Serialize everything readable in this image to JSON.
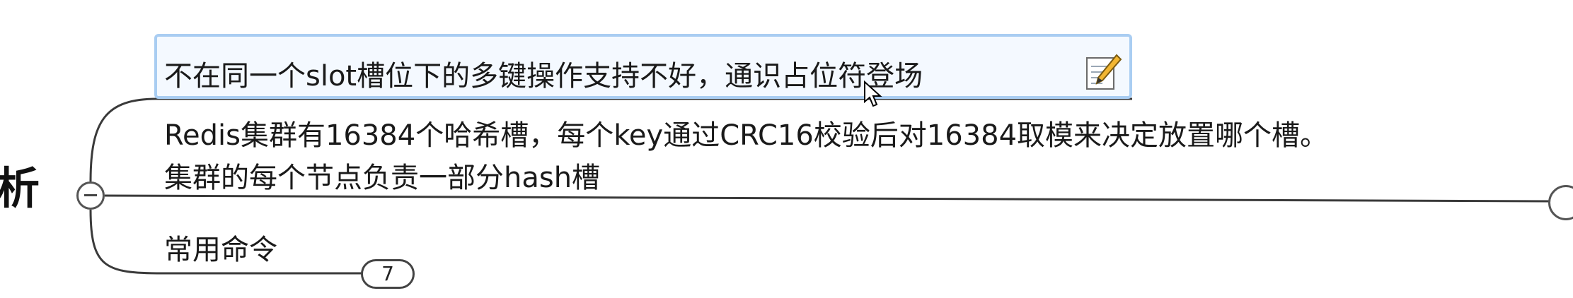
{
  "parent_topic": {
    "label_fragment": "析"
  },
  "subtopics": [
    {
      "text": "不在同一个slot槽位下的多键操作支持不好，通识占位符登场",
      "selected": true,
      "has_note": true
    },
    {
      "lines": [
        "Redis集群有16384个哈希槽，每个key通过CRC16校验后对16384取模来决定放置哪个槽。",
        "集群的每个节点负责一部分hash槽"
      ]
    },
    {
      "text": "常用命令",
      "collapsed_count": "7"
    }
  ],
  "icons": {
    "note": "note-pencil-icon",
    "collapse": "collapse-minus-icon",
    "cursor": "mouse-cursor-icon"
  },
  "colors": {
    "selection_border": "#a9cdf2",
    "selection_fill": "#f4f9ff",
    "line": "#3a3a3a"
  }
}
